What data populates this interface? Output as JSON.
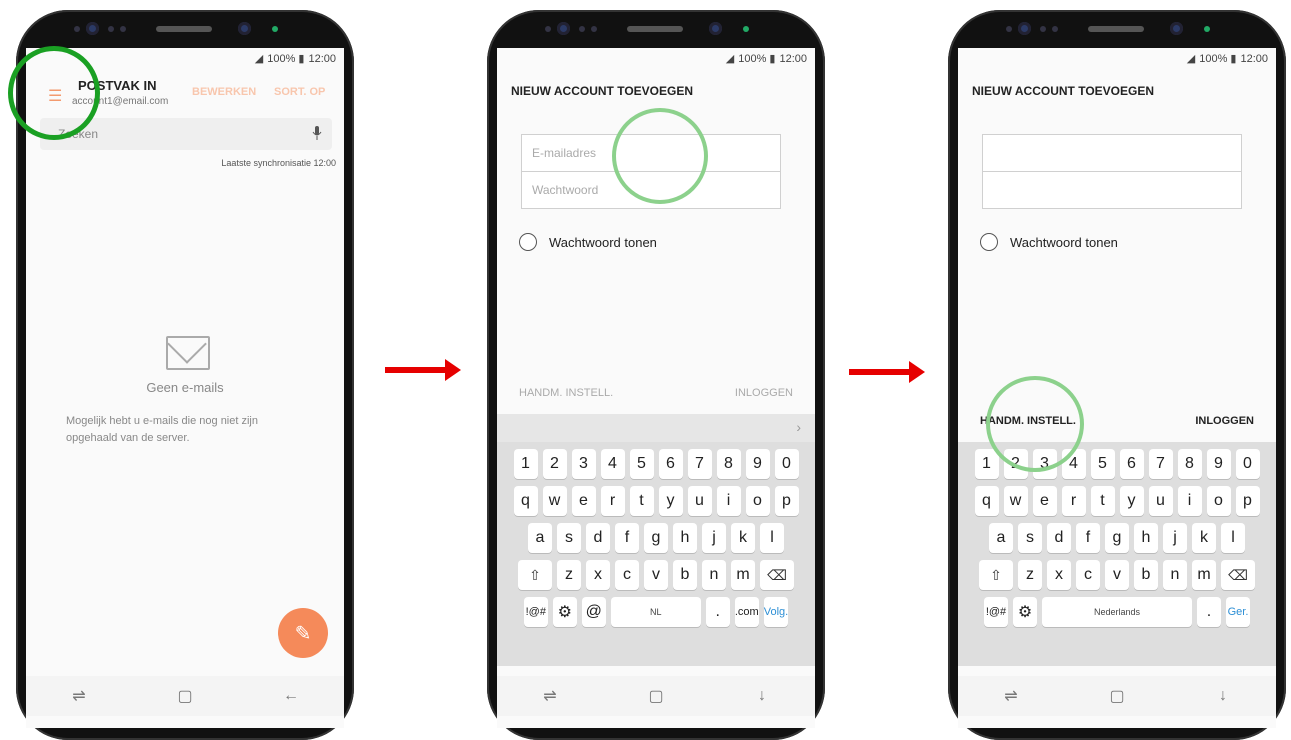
{
  "status": {
    "signal": "◢",
    "battery": "100% ▮",
    "time": "12:00"
  },
  "screen1": {
    "title": "POSTVAK IN",
    "account": "account1@email.com",
    "edit_label": "BEWERKEN",
    "sort_label": "SORT. OP",
    "search_placeholder": "Zoeken",
    "sync_text": "Laatste synchronisatie  12:00",
    "empty_title": "Geen e-mails",
    "empty_text": "Mogelijk hebt u e-mails die nog niet zijn opgehaald van de server."
  },
  "screen2": {
    "title": "NIEUW ACCOUNT TOEVOEGEN",
    "email_placeholder": "E-mailadres",
    "password_placeholder": "Wachtwoord",
    "show_password": "Wachtwoord tonen",
    "manual_label": "HANDM. INSTELL.",
    "login_label": "INLOGGEN",
    "suggest_chevron": "›"
  },
  "screen3": {
    "title": "NIEUW ACCOUNT TOEVOEGEN",
    "show_password": "Wachtwoord tonen",
    "manual_label": "HANDM. INSTELL.",
    "login_label": "INLOGGEN"
  },
  "keyboard": {
    "row_numbers": [
      "1",
      "2",
      "3",
      "4",
      "5",
      "6",
      "7",
      "8",
      "9",
      "0"
    ],
    "row1": [
      "q",
      "w",
      "e",
      "r",
      "t",
      "y",
      "u",
      "i",
      "o",
      "p"
    ],
    "row2": [
      "a",
      "s",
      "d",
      "f",
      "g",
      "h",
      "j",
      "k",
      "l"
    ],
    "row3": [
      "z",
      "x",
      "c",
      "v",
      "b",
      "n",
      "m"
    ],
    "shift": "⇧",
    "backspace": "⌫",
    "symbols": "!@#",
    "settings": "⚙",
    "at": "@",
    "space2": "NL",
    "space3": "Nederlands",
    "dot": ".",
    "dotcom": ".com",
    "next2": "Volg.",
    "next3": "Ger."
  },
  "nav": {
    "recents": "⇌",
    "home": "▢",
    "back1": "←",
    "back2": "↓"
  },
  "colors": {
    "accent_orange": "#f58a5a",
    "highlight_green": "#1aa023",
    "arrow_red": "#e60000"
  }
}
